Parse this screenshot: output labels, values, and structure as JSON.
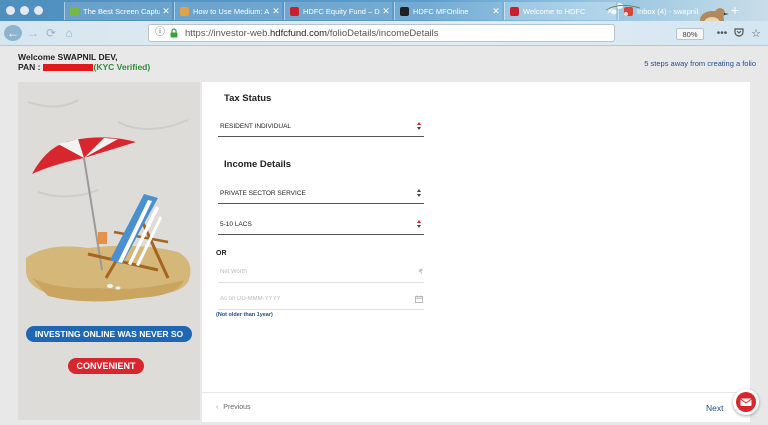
{
  "browser": {
    "tabs": [
      {
        "title": "The Best Screen Captu",
        "favicon_color": "#7ab648",
        "active": false
      },
      {
        "title": "How to Use Medium: A",
        "favicon_color": "#e0a24b",
        "active": false
      },
      {
        "title": "HDFC Equity Fund – D",
        "favicon_color": "#c8202f",
        "active": false
      },
      {
        "title": "HDFC MFOnline",
        "favicon_color": "#1f1f1f",
        "active": false
      },
      {
        "title": "Welcome to HDFC",
        "favicon_color": "#c8202f",
        "active": true
      },
      {
        "title": "Inbox (4) - swapnil",
        "favicon_color": "#d44638",
        "active": false
      }
    ],
    "url_prefix": "https://investor-web.",
    "url_domain": "hdfcfund.com",
    "url_path": "/folioDetails/incomeDetails",
    "zoom": "80%",
    "new_tab_symbol": "+",
    "more_symbol": "•••",
    "bookmark_symbol": "☆"
  },
  "header": {
    "welcome": "Welcome SWAPNIL DEV,",
    "pan_label": "PAN :",
    "kyc_status": "(KYC Verified)",
    "steps_text": "5 steps away from creating a folio"
  },
  "banner": {
    "line1": "INVESTING ONLINE WAS NEVER SO",
    "line2": "CONVENIENT"
  },
  "form": {
    "tax_status_title": "Tax Status",
    "tax_status_value": "RESIDENT INDIVIDUAL",
    "income_details_title": "Income Details",
    "occupation_value": "PRIVATE SECTOR SERVICE",
    "income_value": "5-10 LACS",
    "or_label": "OR",
    "net_worth_placeholder": "Net Worth",
    "net_worth_symbol": "₹",
    "date_placeholder": "As on DD-MMM-YYYY",
    "date_hint": "(Not older than 1year)"
  },
  "footer": {
    "previous_label": "Previous",
    "next_label": "Next"
  },
  "colors": {
    "accent_blue": "#1f4e8c",
    "kyc_green": "#2e8c37",
    "redact_red": "#e0191d"
  }
}
